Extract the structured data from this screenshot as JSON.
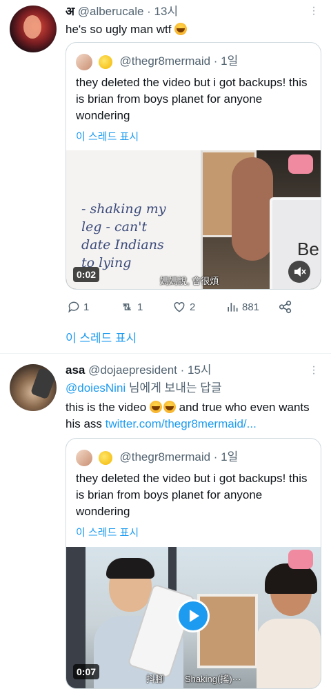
{
  "tweets": [
    {
      "author_glyph": "अ",
      "handle": "@alberucale",
      "time": "· 13시",
      "text": "he's so ugly man wtf",
      "quote": {
        "handle": "@thegr8mermaid",
        "time": "· 1일",
        "text": "they deleted the video but i got backups! this is brian from boys planet for anyone wondering",
        "show_thread": "이 스레드 표시",
        "video_duration": "0:02",
        "subtitle": "媽媽說, 會很煩",
        "board_text": "- shaking my leg - can't date Indians to lying",
        "board_right": "Be"
      },
      "actions": {
        "reply": "1",
        "retweet": "1",
        "like": "2",
        "views": "881"
      },
      "show_thread": "이 스레드 표시"
    },
    {
      "author": "asa",
      "handle": "@dojaepresident",
      "time": "· 15시",
      "reply_to_handle": "@doiesNini",
      "reply_to_suffix": " 님에게 보내는 답글",
      "text_before": "this is the video ",
      "text_after": " and true who even wants his ass ",
      "link": "twitter.com/thegr8mermaid/...",
      "quote": {
        "handle": "@thegr8mermaid",
        "time": "· 1일",
        "text": "they deleted the video but i got backups! this is brian from boys planet for anyone wondering",
        "show_thread": "이 스레드 표시",
        "video_duration": "0:07",
        "subtitle_left": "抖腳",
        "subtitle_right": "Shaking(搖)···"
      }
    }
  ]
}
